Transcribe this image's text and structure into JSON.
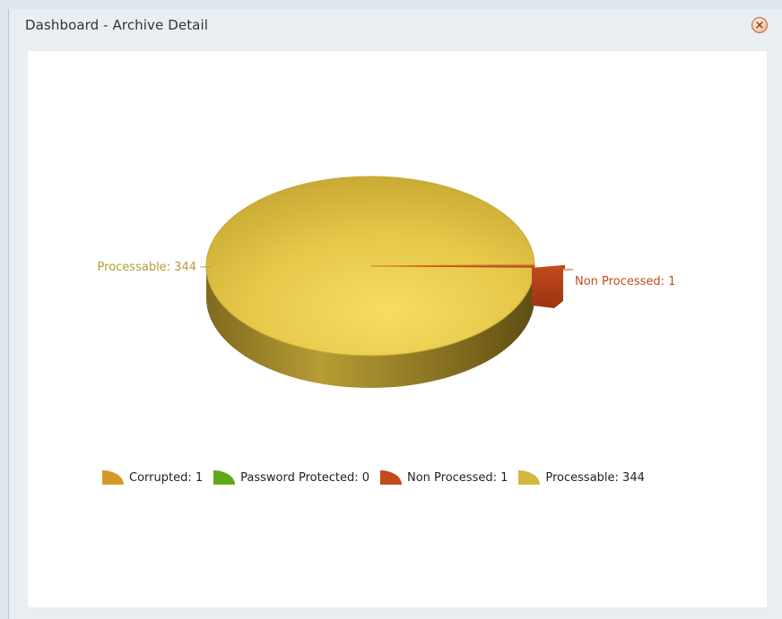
{
  "window": {
    "title": "Dashboard - Archive Detail"
  },
  "chart_data": {
    "type": "pie",
    "title": "",
    "categories": [
      "Corrupted",
      "Password Protected",
      "Non Processed",
      "Processable"
    ],
    "values": [
      1,
      0,
      1,
      344
    ],
    "colors": [
      "#d49a28",
      "#5fa81a",
      "#c24a1d",
      "#d2b640"
    ],
    "slice_labels": [
      "Non Processed: 1",
      "Processable: 344"
    ],
    "legend": [
      "Corrupted: 1",
      "Password Protected: 0",
      "Non Processed: 1",
      "Processable: 344"
    ],
    "legend_placement": "bottom"
  }
}
